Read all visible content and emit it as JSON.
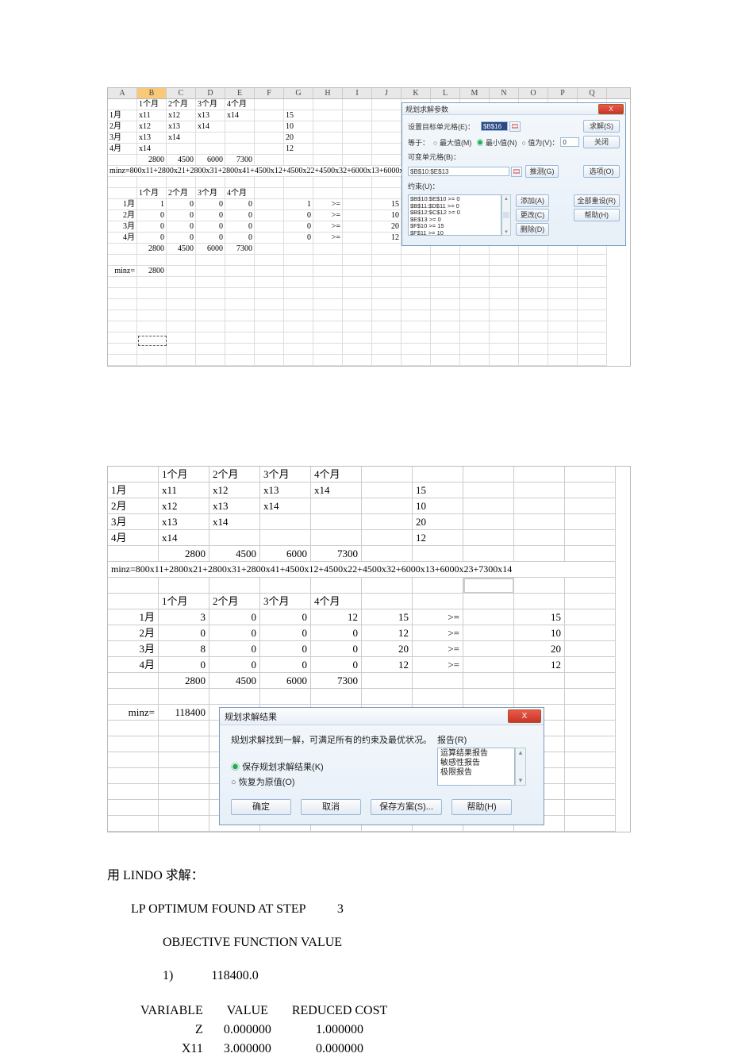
{
  "columns_small": [
    "A",
    "B",
    "C",
    "D",
    "E",
    "F",
    "G",
    "H",
    "I",
    "J",
    "K",
    "L",
    "M",
    "N",
    "O",
    "P",
    "Q"
  ],
  "ss1": {
    "header_row": [
      "",
      "1个月",
      "2个月",
      "3个月",
      "4个月"
    ],
    "model_rows": [
      [
        "1月",
        "x11",
        "x12",
        "x13",
        "x14",
        "",
        "15"
      ],
      [
        "2月",
        "x12",
        "x13",
        "x14",
        "",
        "",
        "10"
      ],
      [
        "3月",
        "x13",
        "x14",
        "",
        "",
        "",
        "20"
      ],
      [
        "4月",
        "x14",
        "",
        "",
        "",
        "",
        "12"
      ]
    ],
    "cost_row": [
      "",
      "2800",
      "4500",
      "6000",
      "7300"
    ],
    "minz_expr": "minz=800x11+2800x21+2800x31+2800x41+4500x12+4500x22+4500x32+6000x13+6000x23+7300x14",
    "mat_header": [
      "",
      "1个月",
      "2个月",
      "3个月",
      "4个月"
    ],
    "mat": [
      [
        "1月",
        "1",
        "0",
        "0",
        "0",
        "1",
        ">=",
        "",
        "15"
      ],
      [
        "2月",
        "0",
        "0",
        "0",
        "0",
        "0",
        ">=",
        "",
        "10"
      ],
      [
        "3月",
        "0",
        "0",
        "0",
        "0",
        "0",
        ">=",
        "",
        "20"
      ],
      [
        "4月",
        "0",
        "0",
        "0",
        "0",
        "0",
        ">=",
        "",
        "12"
      ]
    ],
    "cost_row2": [
      "",
      "2800",
      "4500",
      "6000",
      "7300"
    ],
    "minz_label": "minz=",
    "minz_value": "2800"
  },
  "solver_params": {
    "title": "规划求解参数",
    "target_label": "设置目标单元格(E)：",
    "target_val": "$B$16",
    "equal_label": "等于：",
    "radio_max": "最大值(M)",
    "radio_min": "最小值(N)",
    "radio_val": "值为(V)：",
    "val_input": "0",
    "var_label": "可变单元格(B)：",
    "var_val": "$B$10:$E$13",
    "guess_btn": "推测(G)",
    "constraints_label": "约束(U)：",
    "constraints": [
      "$B$10:$E$10 >= 0",
      "$B$11:$D$11 >= 0",
      "$B$12:$C$12 >= 0",
      "$E$13 >= 0",
      "$F$10 >= 15",
      "$F$11 >= 10"
    ],
    "btn_solve": "求解(S)",
    "btn_close": "关闭",
    "btn_options": "选项(O)",
    "btn_add": "添加(A)",
    "btn_change": "更改(C)",
    "btn_delete": "删除(D)",
    "btn_resetall": "全部重设(R)",
    "btn_help": "帮助(H)"
  },
  "ss2": {
    "header_row": [
      "",
      "1个月",
      "2个月",
      "3个月",
      "4个月"
    ],
    "model_rows": [
      [
        "1月",
        "x11",
        "x12",
        "x13",
        "x14",
        "",
        "15"
      ],
      [
        "2月",
        "x12",
        "x13",
        "x14",
        "",
        "",
        "10"
      ],
      [
        "3月",
        "x13",
        "x14",
        "",
        "",
        "",
        "20"
      ],
      [
        "4月",
        "x14",
        "",
        "",
        "",
        "",
        "12"
      ]
    ],
    "cost_row": [
      "",
      "2800",
      "4500",
      "6000",
      "7300"
    ],
    "minz_expr": "minz=800x11+2800x21+2800x31+2800x41+4500x12+4500x22+4500x32+6000x13+6000x23+7300x14",
    "mat_header": [
      "",
      "1个月",
      "2个月",
      "3个月",
      "4个月"
    ],
    "mat": [
      [
        "1月",
        "3",
        "0",
        "0",
        "12",
        "15",
        ">=",
        "",
        "15"
      ],
      [
        "2月",
        "0",
        "0",
        "0",
        "0",
        "12",
        ">=",
        "",
        "10"
      ],
      [
        "3月",
        "8",
        "0",
        "0",
        "0",
        "20",
        ">=",
        "",
        "20"
      ],
      [
        "4月",
        "0",
        "0",
        "0",
        "0",
        "12",
        ">=",
        "",
        "12"
      ]
    ],
    "cost_row2": [
      "",
      "2800",
      "4500",
      "6000",
      "7300"
    ],
    "minz_label": "minz=",
    "minz_value": "118400"
  },
  "solver_results": {
    "title": "规划求解结果",
    "msg": "规划求解找到一解，可满足所有的约束及最优状况。",
    "keep": "保存规划求解结果(K)",
    "restore": "恢复为原值(O)",
    "reports_label": "报告(R)",
    "reports": [
      "运算结果报告",
      "敏感性报告",
      "极限报告"
    ],
    "btn_ok": "确定",
    "btn_cancel": "取消",
    "btn_save": "保存方案(S)...",
    "btn_help": "帮助(H)"
  },
  "doc": {
    "lindo_line": "用 LINDO 求解：",
    "opt_line": "LP OPTIMUM FOUND AT STEP          3",
    "obj_line": "OBJECTIVE FUNCTION VALUE",
    "obj_val": "1)            118400.0",
    "tbl_hdr": [
      "VARIABLE",
      "VALUE",
      "REDUCED COST"
    ],
    "tbl_rows": [
      [
        "Z",
        "0.000000",
        "1.000000"
      ],
      [
        "X11",
        "3.000000",
        "0.000000"
      ]
    ]
  }
}
